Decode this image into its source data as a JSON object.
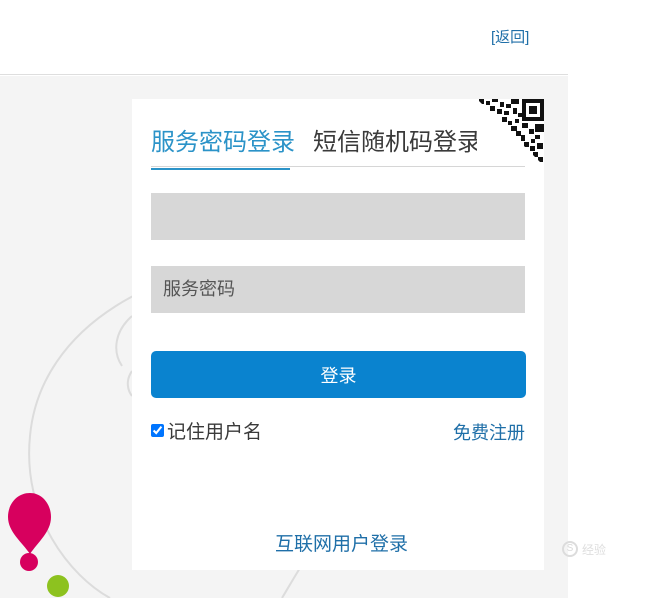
{
  "header": {
    "back_label": "[返回]"
  },
  "login": {
    "tabs": [
      {
        "label": "服务密码登录",
        "active": true
      },
      {
        "label": "短信随机码登录",
        "active": false
      }
    ],
    "account_field": {
      "placeholder": "",
      "value": ""
    },
    "password_field": {
      "placeholder": "服务密码",
      "value": ""
    },
    "submit_label": "登录",
    "remember": {
      "label": "记住用户名",
      "checked": true
    },
    "register_label": "免费注册",
    "internet_login_label": "互联网用户登录"
  },
  "watermark": {
    "text": "经验"
  },
  "colors": {
    "accent": "#2b93c8",
    "button": "#0a83cf",
    "link": "#1f6fa8",
    "field_bg": "#d7d7d7",
    "stage_bg": "#f4f4f4",
    "balloon_pink": "#d7005e",
    "balloon_green": "#8dc21f"
  }
}
